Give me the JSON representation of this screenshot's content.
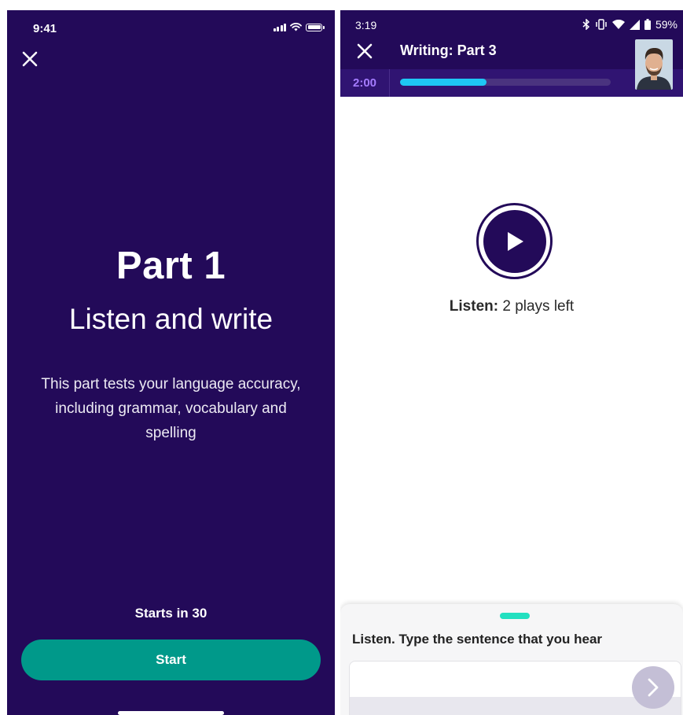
{
  "left_screen": {
    "status_time": "9:41",
    "part_title": "Part 1",
    "part_subtitle": "Listen and write",
    "description": "This part tests your language accuracy, including grammar, vocabulary and spelling",
    "starts_in": "Starts in 30",
    "start_label": "Start",
    "icons": [
      "signal-icon",
      "wifi-icon",
      "battery-icon",
      "close-icon"
    ]
  },
  "right_screen": {
    "status_time": "3:19",
    "battery_percent": "59%",
    "header_title": "Writing: Part 3",
    "timer": "2:00",
    "progress": 0.41,
    "listen_label": "Listen:",
    "plays_left": "2 plays left",
    "sheet_prompt": "Listen. Type the sentence that you hear",
    "answer_value": "",
    "icons": [
      "bluetooth-icon",
      "vibrate-icon",
      "wifi-icon",
      "cell-signal-icon",
      "battery-icon",
      "close-icon",
      "play-icon",
      "chevron-right-icon"
    ]
  },
  "colors": {
    "brand_purple": "#230a59",
    "start_button": "#00998a",
    "progress_fill": "#1ec7f4",
    "timer_text": "#a57cff",
    "sheet_handle": "#22e0c0"
  }
}
